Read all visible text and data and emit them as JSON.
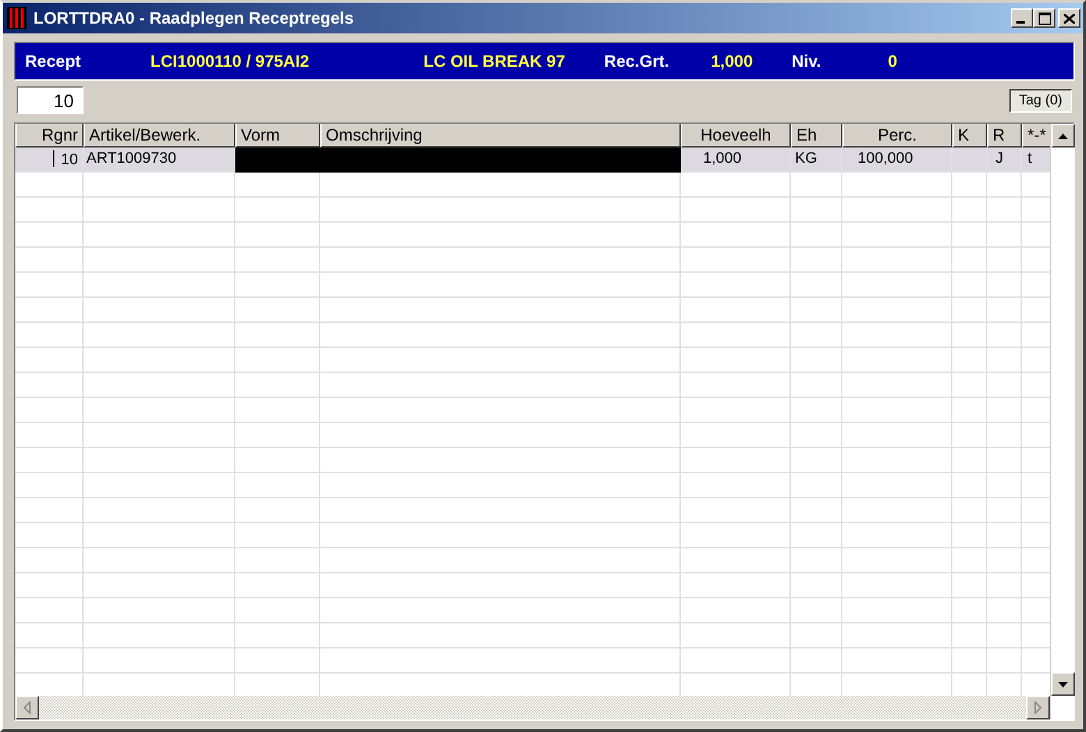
{
  "window": {
    "title": "LORTTDRA0 - Raadplegen Receptregels"
  },
  "header": [
    {
      "kind": "label",
      "text": "Recept"
    },
    {
      "kind": "value",
      "text": "LCI1000110 / 975AI2"
    },
    {
      "kind": "value",
      "text": "LC OIL BREAK 97"
    },
    {
      "kind": "label",
      "text": "Rec.Grt."
    },
    {
      "kind": "value",
      "text": "1,000"
    },
    {
      "kind": "label",
      "text": "Niv."
    },
    {
      "kind": "value",
      "text": "0"
    }
  ],
  "line_field": {
    "value": "10"
  },
  "tag_button": "Tag (0)",
  "table": {
    "columns": [
      "Rgnr",
      "Artikel/Bewerk.",
      "Vorm",
      "Omschrijving",
      "Hoeveelh",
      "Eh",
      "Perc.",
      "K",
      "R",
      "*-*"
    ],
    "rows": [
      {
        "selected": true,
        "cursor": true,
        "cells": [
          {
            "text": "10"
          },
          {
            "text": "ART1009730"
          },
          {
            "redacted": true
          },
          {
            "redacted": true
          },
          {
            "text": "1,000"
          },
          {
            "text": "KG"
          },
          {
            "text": "100,000"
          },
          {},
          {
            "text": "J"
          },
          {
            "text": "t"
          }
        ]
      }
    ]
  }
}
